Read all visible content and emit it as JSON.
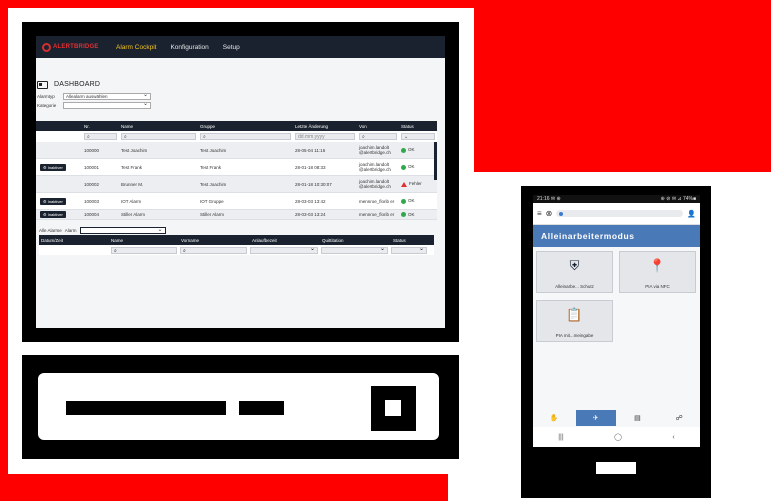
{
  "app": {
    "brand": "ALERTBRIDGE",
    "nav": [
      "Alarm Cockpit",
      "Konfiguration",
      "Setup"
    ],
    "active_nav": 0
  },
  "dashboard": {
    "title": "DASHBOARD",
    "filters": [
      {
        "label": "Alarmtyp",
        "value": "Allealarm auswählen"
      },
      {
        "label": "Kategorie",
        "value": ""
      }
    ]
  },
  "alarm_table": {
    "columns": [
      "",
      "Nr.",
      "Name",
      "Gruppe",
      "Letzte Änderung",
      "Von",
      "Status"
    ],
    "search_placeholder": "dd.mm.yyyy",
    "rows": [
      {
        "action": "",
        "nr": "100000",
        "name": "Test Joachim",
        "group": "Test Joachim",
        "changed": "28-05-04 11:16",
        "by": "joachim.landolt @alertbridge.ch",
        "status": "OK",
        "status_type": "ok"
      },
      {
        "action": "Inaktiver",
        "nr": "100001",
        "name": "Test Frank",
        "group": "Test Frank",
        "changed": "28-01-18 08:33",
        "by": "joachim.landolt @alertbridge.ch",
        "status": "OK",
        "status_type": "ok"
      },
      {
        "action": "",
        "nr": "100002",
        "name": "Brunner M.",
        "group": "Test Joachim",
        "changed": "28-01-18 10:30:07",
        "by": "joachim.landolt @alertbridge.ch",
        "status": "Fehler",
        "status_type": "error"
      },
      {
        "action": "Inaktiver",
        "nr": "100003",
        "name": "IOT Alarm",
        "group": "IOT Gruppe",
        "changed": "28-03-03 13:42",
        "by": "mennroe_florib er",
        "status": "OK",
        "status_type": "ok"
      },
      {
        "action": "Inaktiver",
        "nr": "100004",
        "name": "Stiller Alarm",
        "group": "Stiller Alarm",
        "changed": "28-03-03 13:24",
        "by": "mennroe_florib er",
        "status": "OK",
        "status_type": "ok"
      }
    ]
  },
  "history": {
    "filter_prefix": "Alle Alarme",
    "filter_label": "Alarm",
    "columns": [
      "Datum/Zeit",
      "Name",
      "Vorname",
      "Anlaufbezeit",
      "Quittitation",
      "Status"
    ]
  },
  "phone": {
    "status_left": "21:16 ✉ ⊕",
    "status_right": "⊕ ⊘ ✉ ⊿ 74%■",
    "title": "Alleinarbeitermodus",
    "tiles": [
      {
        "label": "Alleinarbe... Schutz",
        "icon": "shield-person-icon"
      },
      {
        "label": "PIA via NFC",
        "icon": "nfc-location-icon"
      },
      {
        "label": "PIA mit...meingabe",
        "icon": "clipboard-icon"
      }
    ],
    "bottom_nav": [
      "hand-icon",
      "alarm-person-icon",
      "calculator-icon",
      "group-icon"
    ],
    "active_bottom": 1,
    "system_nav": [
      "|||",
      "◯",
      "‹"
    ]
  }
}
